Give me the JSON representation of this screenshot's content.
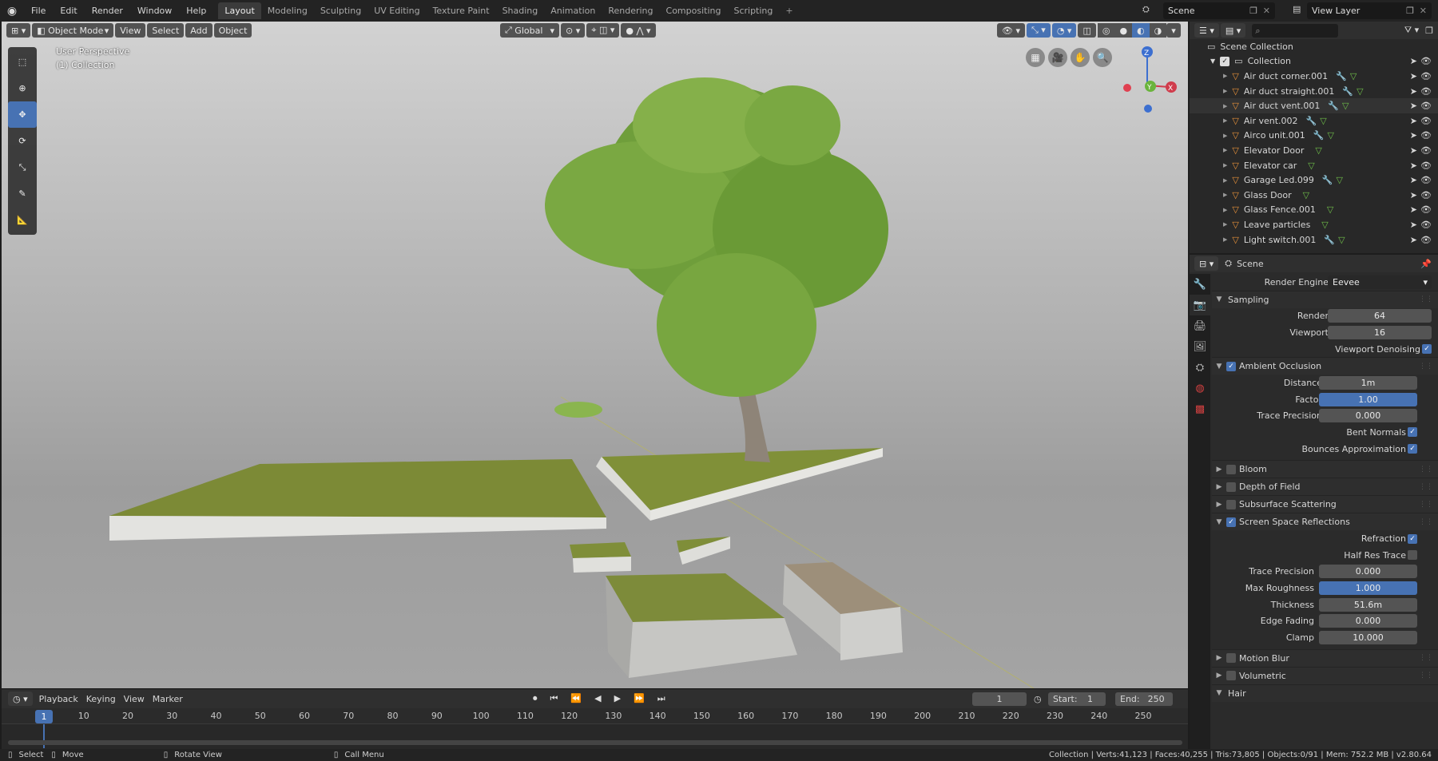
{
  "topbar": {
    "menus": [
      "File",
      "Edit",
      "Render",
      "Window",
      "Help"
    ],
    "workspaces": [
      "Layout",
      "Modeling",
      "Sculpting",
      "UV Editing",
      "Texture Paint",
      "Shading",
      "Animation",
      "Rendering",
      "Compositing",
      "Scripting"
    ],
    "active_workspace": "Layout",
    "scene_name": "Scene",
    "view_layer": "View Layer"
  },
  "viewport": {
    "mode": "Object Mode",
    "menus": [
      "View",
      "Select",
      "Add",
      "Object"
    ],
    "transform_orientation": "Global",
    "perspective_label": "User Perspective",
    "collection_label": "(1) Collection",
    "gizmo_axes": {
      "z": "Z",
      "y": "Y",
      "x": "X"
    }
  },
  "outliner": {
    "root": "Scene Collection",
    "collection": "Collection",
    "items": [
      {
        "name": "Air duct corner.001",
        "modifier": true
      },
      {
        "name": "Air duct straight.001",
        "modifier": true
      },
      {
        "name": "Air duct vent.001",
        "modifier": true,
        "selected": true
      },
      {
        "name": "Air vent.002",
        "modifier": true
      },
      {
        "name": "Airco unit.001",
        "modifier": true
      },
      {
        "name": "Elevator Door",
        "modifier": false
      },
      {
        "name": "Elevator car",
        "modifier": false
      },
      {
        "name": "Garage Led.099",
        "modifier": true
      },
      {
        "name": "Glass Door",
        "modifier": false
      },
      {
        "name": "Glass Fence.001",
        "modifier": false
      },
      {
        "name": "Leave particles",
        "modifier": false
      },
      {
        "name": "Light switch.001",
        "modifier": true
      }
    ]
  },
  "properties": {
    "context": "Scene",
    "render_engine_label": "Render Engine",
    "render_engine": "Eevee",
    "sampling": {
      "title": "Sampling",
      "render_label": "Render",
      "render": "64",
      "viewport_label": "Viewport",
      "viewport": "16",
      "denoise_label": "Viewport Denoising"
    },
    "ao": {
      "title": "Ambient Occlusion",
      "distance_label": "Distance",
      "distance": "1m",
      "factor_label": "Factor",
      "factor": "1.00",
      "trace_label": "Trace Precision",
      "trace": "0.000",
      "bent_label": "Bent Normals",
      "bounces_label": "Bounces Approximation"
    },
    "collapsed": [
      "Bloom",
      "Depth of Field",
      "Subsurface Scattering"
    ],
    "ssr": {
      "title": "Screen Space Reflections",
      "refraction_label": "Refraction",
      "halfres_label": "Half Res Trace",
      "trace_label": "Trace Precision",
      "trace": "0.000",
      "roughness_label": "Max Roughness",
      "roughness": "1.000",
      "thickness_label": "Thickness",
      "thickness": "51.6m",
      "fading_label": "Edge Fading",
      "fading": "0.000",
      "clamp_label": "Clamp",
      "clamp": "10.000"
    },
    "collapsed2": [
      "Motion Blur",
      "Volumetric"
    ],
    "hair": "Hair"
  },
  "timeline": {
    "menus": [
      "Playback",
      "Keying",
      "View",
      "Marker"
    ],
    "current_frame": "1",
    "start_label": "Start:",
    "start": "1",
    "end_label": "End:",
    "end": "250",
    "ticks": [
      "1",
      "10",
      "20",
      "30",
      "40",
      "50",
      "60",
      "70",
      "80",
      "90",
      "100",
      "110",
      "120",
      "130",
      "140",
      "150",
      "160",
      "170",
      "180",
      "190",
      "200",
      "210",
      "220",
      "230",
      "240",
      "250"
    ]
  },
  "status": {
    "select": "Select",
    "move": "Move",
    "rotate": "Rotate View",
    "call_menu": "Call Menu",
    "stats": "Collection | Verts:41,123 | Faces:40,255 | Tris:73,805 | Objects:0/91 | Mem: 752.2 MB | v2.80.64"
  },
  "colors": {
    "accent": "#4772b3",
    "orange": "#e8923a",
    "green": "#6fbf4a"
  }
}
